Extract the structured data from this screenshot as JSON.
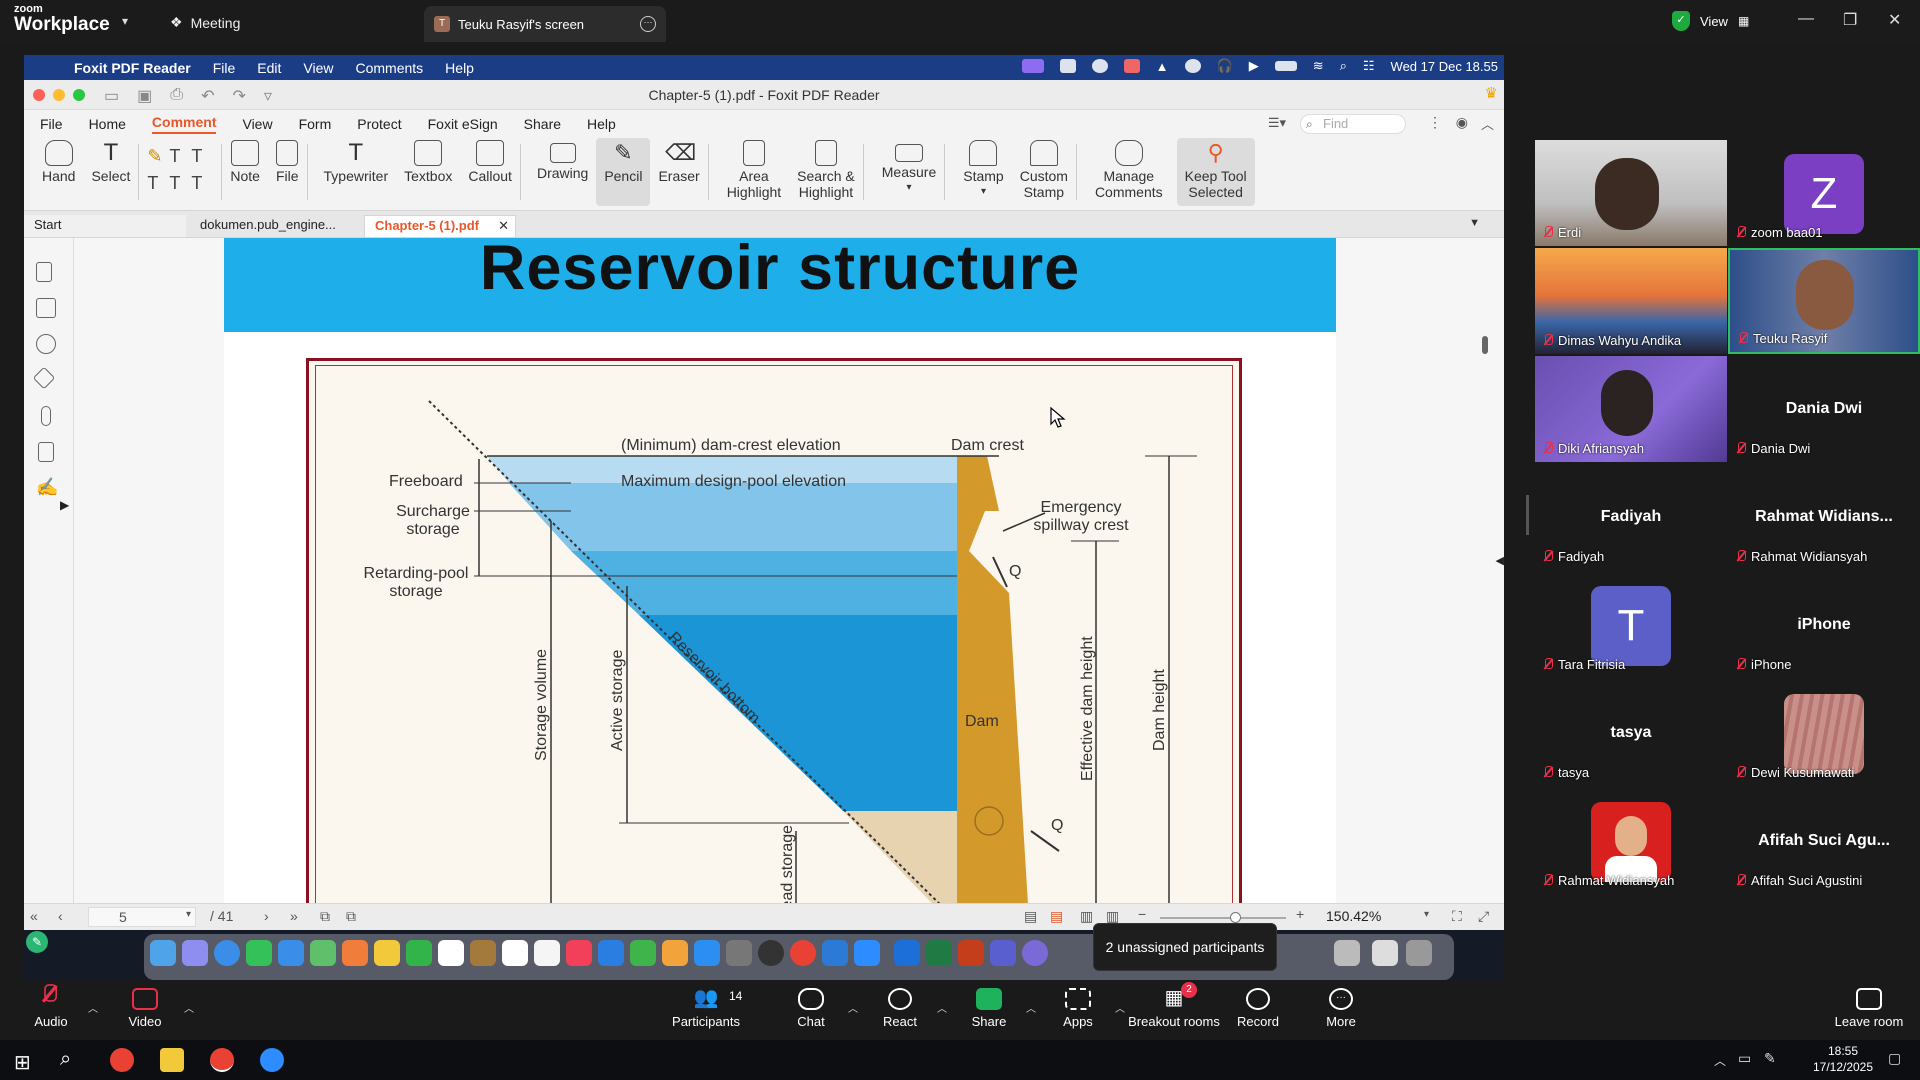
{
  "zoom_top": {
    "logo_line1": "zoom",
    "logo_line2": "Workplace",
    "meeting_label": "Meeting",
    "share_tab_label": "Teuku Rasyif's screen",
    "share_tab_avatar": "T",
    "view_label": "View"
  },
  "mac_menubar": {
    "app_name": "Foxit PDF Reader",
    "items": [
      "File",
      "Edit",
      "View",
      "Comments",
      "Help"
    ],
    "datetime": "Wed 17 Dec 18.55"
  },
  "foxit": {
    "window_title": "Chapter-5 (1).pdf - Foxit PDF Reader",
    "menu_tabs": [
      "File",
      "Home",
      "Comment",
      "View",
      "Form",
      "Protect",
      "Foxit eSign",
      "Share",
      "Help"
    ],
    "active_menu_tab": "Comment",
    "find_placeholder": "Find",
    "tools": {
      "hand": "Hand",
      "select": "Select",
      "note": "Note",
      "file": "File",
      "typewriter": "Typewriter",
      "textbox": "Textbox",
      "callout": "Callout",
      "drawing": "Drawing",
      "pencil": "Pencil",
      "eraser": "Eraser",
      "area_highlight_1": "Area",
      "area_highlight_2": "Highlight",
      "search_highlight_1": "Search &",
      "search_highlight_2": "Highlight",
      "measure": "Measure",
      "stamp": "Stamp",
      "custom_stamp_1": "Custom",
      "custom_stamp_2": "Stamp",
      "manage_comments_1": "Manage",
      "manage_comments_2": "Comments",
      "keep_tool_1": "Keep Tool",
      "keep_tool_2": "Selected"
    },
    "doc_tabs": [
      "Start",
      "dokumen.pub_engine...",
      "Chapter-5 (1).pdf"
    ],
    "active_doc_tab": "Chapter-5 (1).pdf",
    "page_banner_title": "Reservoir structure",
    "diagram_labels": {
      "min_crest": "(Minimum) dam-crest elevation",
      "max_pool": "Maximum design-pool elevation",
      "dam_crest": "Dam crest",
      "freeboard": "Freeboard",
      "surcharge_1": "Surcharge",
      "surcharge_2": "storage",
      "retarding_1": "Retarding-pool",
      "retarding_2": "storage",
      "emergency_1": "Emergency",
      "emergency_2": "spillway crest",
      "q_top": "Q",
      "q_bottom": "Q",
      "storage_volume": "Storage volume",
      "active_storage": "Active storage",
      "reservoir_bottom": "Reservoir bottom",
      "dead_storage": "Dead storage",
      "dam": "Dam",
      "effective_dam_height": "Effective dam height",
      "dam_height": "Dam height"
    },
    "status": {
      "current_page": "5",
      "total_pages": "/ 41",
      "zoom": "150.42%"
    }
  },
  "dock_tooltip": "2 unassigned participants",
  "participants": [
    {
      "name": "Erdi",
      "type": "video"
    },
    {
      "name": "zoom baa01",
      "type": "avatar",
      "initial": "Z",
      "color": "#7b3fc4"
    },
    {
      "name": "Dimas Wahyu Andika",
      "type": "video"
    },
    {
      "name": "Teuku Rasyif",
      "type": "video",
      "active_speaker": true
    },
    {
      "name": "Diki Afriansyah",
      "type": "video"
    },
    {
      "name": "Dania Dwi",
      "type": "name",
      "display": "Dania Dwi"
    },
    {
      "name": "Fadiyah",
      "type": "name",
      "display": "Fadiyah"
    },
    {
      "name": "Rahmat Widiansyah",
      "type": "name",
      "display": "Rahmat  Widians..."
    },
    {
      "name": "Tara Fitrisia",
      "type": "avatar",
      "initial": "T",
      "color": "#5b5fc7"
    },
    {
      "name": "iPhone",
      "type": "name",
      "display": "iPhone"
    },
    {
      "name": "tasya",
      "type": "name",
      "display": "tasya"
    },
    {
      "name": "Dewi Kusumawati",
      "type": "photo"
    },
    {
      "name": "Rahmat Widiansyah",
      "type": "photo"
    },
    {
      "name": "Afifah Suci Agustini",
      "type": "name",
      "display": "Afifah Suci Agu..."
    }
  ],
  "zoom_toolbar": {
    "audio": "Audio",
    "video": "Video",
    "participants": "Participants",
    "participants_count": "14",
    "chat": "Chat",
    "react": "React",
    "share": "Share",
    "apps": "Apps",
    "breakout": "Breakout rooms",
    "breakout_badge": "2",
    "record": "Record",
    "more": "More",
    "leave": "Leave room"
  },
  "taskbar": {
    "time": "18:55",
    "date": "17/12/2025"
  },
  "colors": {
    "mac_menubar": "#1b3d86",
    "foxit_accent": "#e8582a",
    "banner_blue": "#1eaee9",
    "frame_red": "#8b1020",
    "dam_gold": "#d39a2b",
    "active_speaker_border": "#2fbf62",
    "share_green": "#1db25b"
  }
}
